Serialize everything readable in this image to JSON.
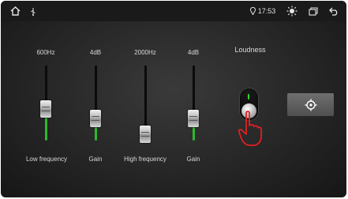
{
  "status_bar": {
    "home_icon": "home-icon",
    "usb_icon": "usb-icon",
    "location_icon": "location-pin-icon",
    "time": "17:53",
    "brightness_icon": "brightness-icon",
    "windows_icon": "recent-apps-icon",
    "back_icon": "back-arrow-icon"
  },
  "equalizer": {
    "sliders": [
      {
        "top_value": "600Hz",
        "bottom_label": "Low frequency",
        "level": 0.4
      },
      {
        "top_value": "4dB",
        "bottom_label": "Gain",
        "level": 0.25
      },
      {
        "top_value": "2000Hz",
        "bottom_label": "High frequency",
        "level": 0.0
      },
      {
        "top_value": "4dB",
        "bottom_label": "Gain",
        "level": 0.25
      }
    ]
  },
  "loudness": {
    "title": "Loudness",
    "state": "on"
  },
  "target_button": {
    "icon": "crosshair-icon"
  },
  "colors": {
    "fill_green": "#2eb82e",
    "background": "#262626",
    "pointer_red": "#e02020"
  }
}
